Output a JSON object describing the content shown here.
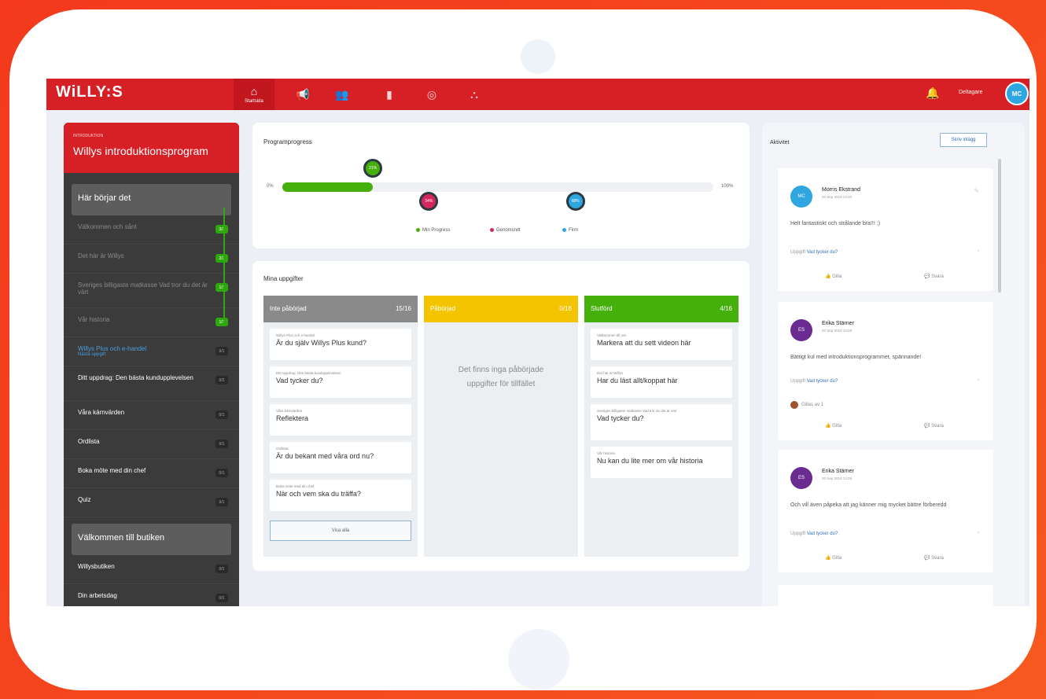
{
  "app": {
    "logo": "WiLLY:S"
  },
  "nav": {
    "items": [
      {
        "icon": "home-icon",
        "label": "Startsida",
        "glyph": "⌂"
      },
      {
        "icon": "megaphone-icon",
        "glyph": "📢"
      },
      {
        "icon": "people-icon",
        "glyph": "👥"
      },
      {
        "icon": "folder-icon",
        "glyph": "▮"
      },
      {
        "icon": "target-icon",
        "glyph": "◎"
      },
      {
        "icon": "network-icon",
        "glyph": "⛬"
      }
    ],
    "user_name": "Deltagare",
    "user_initials": "MC"
  },
  "sidebar": {
    "program_kicker": "INTRODUKTION",
    "program_title": "Willys introduktionsprogram",
    "section1": "Här börjar det",
    "items": [
      {
        "label": "Välkommen och sånt",
        "badge": "3/3",
        "state": "done"
      },
      {
        "label": "Det här är Willys",
        "badge": "2/2",
        "state": "done"
      },
      {
        "label": "Sveriges billigaste matkasse Vad tror du det är värt",
        "badge": "1/1",
        "state": "done"
      },
      {
        "label": "Vår historia",
        "badge": "1/1",
        "state": "done"
      },
      {
        "label": "Willys Plus och e-handel",
        "sub": "Nästa uppgift",
        "badge": "0/1",
        "state": "active"
      },
      {
        "label": "Ditt uppdrag: Den bästa kundupplevelsen",
        "badge": "0/2",
        "state": "todo"
      },
      {
        "label": "Våra kärnvärden",
        "badge": "0/1",
        "state": "todo"
      },
      {
        "label": "Ordlista",
        "badge": "0/1",
        "state": "todo"
      },
      {
        "label": "Boka möte med din chef",
        "badge": "0/1",
        "state": "todo"
      },
      {
        "label": "Quiz",
        "badge": "0/1",
        "state": "todo"
      }
    ],
    "section2": "Välkommen till butiken",
    "items2": [
      {
        "label": "Willysbutiken",
        "badge": "0/1"
      },
      {
        "label": "Din arbetsdag",
        "badge": "0/1"
      }
    ]
  },
  "progress": {
    "title": "Programprogress",
    "min_label": "0%",
    "max_label": "100%",
    "my_progress_pct": 21,
    "my_progress_label": "21%",
    "average_pct": 34,
    "average_label": "34%",
    "goal_pct": 68,
    "goal_label": "68%",
    "legend": [
      "Min Progress",
      "Genomsnitt",
      "Firm"
    ],
    "colors": {
      "mine": "#45b00c",
      "average": "#d6265f",
      "goal": "#2ea7e0"
    }
  },
  "tasks": {
    "title": "Mina uppgifter",
    "columns": [
      {
        "name": "Inte påbörjad",
        "count": "15/16",
        "color": "#8a8a8a",
        "items": [
          {
            "topic": "Willys Plus och e-handel",
            "question": "Är du själv Willys Plus kund?"
          },
          {
            "topic": "Ditt uppdrag: Den bästa kundupplevelsen",
            "question": "Vad tycker du?"
          },
          {
            "topic": "Våra kärnvärden",
            "question": "Reflektera"
          },
          {
            "topic": "Ordlista",
            "question": "Är du bekant med våra ord nu?"
          },
          {
            "topic": "Boka möte med din chef",
            "question": "När och vem ska du träffa?"
          }
        ],
        "show_all": "Visa alla"
      },
      {
        "name": "Påbörjad",
        "count": "0/16",
        "color": "#f5c400",
        "empty": "Det finns inga påbörjade uppgifter för tillfället"
      },
      {
        "name": "Slutförd",
        "count": "4/16",
        "color": "#45b00c",
        "items": [
          {
            "topic": "Välkommen till oss",
            "question": "Markera att du sett videon här"
          },
          {
            "topic": "Det här är Willys",
            "question": "Har du läst allt/koppat här"
          },
          {
            "topic": "Sveriges billigaste matkasse Vad tror du det är värt",
            "question": "Vad tycker du?"
          },
          {
            "topic": "Vår historia",
            "question": "Nu kan du lite mer om vår historia"
          }
        ]
      }
    ]
  },
  "activity": {
    "title": "Aktivitet",
    "button": "Skriv inlägg",
    "posts": [
      {
        "initials": "MC",
        "color": "#2ea7e0",
        "name": "Morris Ekstrand",
        "date": "20 Sep 2018 13:20",
        "body": "Helt fantastiskt och strålande bra!!! :)",
        "question": "Uppgift",
        "question_link": "Vad tycker du?",
        "like": "Gilla",
        "reply": "Svara",
        "liker": ""
      },
      {
        "initials": "ES",
        "color": "#6b2c91",
        "name": "Erika Stärner",
        "date": "20 Sep 2018 13:08",
        "body": "Bättigt kul med introduktionsprogrammet, spännande!",
        "question": "Uppgift",
        "question_link": "Vad tycker du?",
        "like": "Gilla",
        "reply": "Svara",
        "liker": "Gillas av 1"
      },
      {
        "initials": "ES",
        "color": "#6b2c91",
        "name": "Erika Stärner",
        "date": "20 Sep 2018 13:05",
        "body": "Och vill även påpeka att jag känner mig mycket bättre förberedd",
        "question": "Uppgift",
        "question_link": "Vad tycker du?",
        "like": "Gilla",
        "reply": "Svara",
        "liker": ""
      }
    ]
  }
}
